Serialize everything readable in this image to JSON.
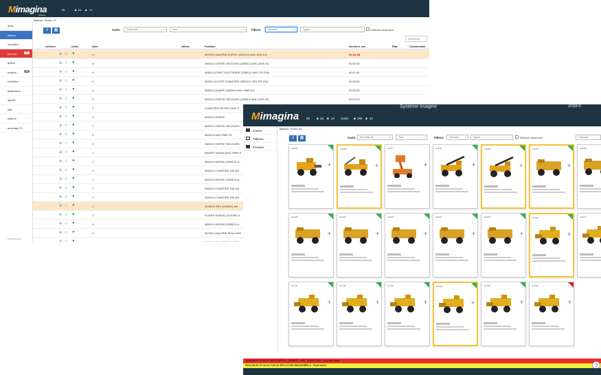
{
  "window1": {
    "app_name": "imagina",
    "app_byline": "by Mappia",
    "stats": [
      "55",
      "63",
      "74"
    ],
    "subtitle": "Tableau: Tiroirs: 43",
    "sidebar": [
      {
        "label": "artes"
      },
      {
        "label": "ableau"
      },
      {
        "label": "opération"
      },
      {
        "label": "bserver",
        "badge": "11"
      },
      {
        "label": "apteur"
      },
      {
        "label": "ocalisa...",
        "badge": "30"
      },
      {
        "label": "entilation"
      },
      {
        "label": "lanificateur"
      },
      {
        "label": "apport"
      },
      {
        "label": "utils"
      },
      {
        "label": "ystème"
      },
      {
        "label": "auvetage R..."
      }
    ],
    "sidebar_footer": "Déconnexion",
    "filters": {
      "carte_label": "Carte:",
      "carte_value": "Souterrain",
      "carte2_value": "Tout",
      "filtres_label": "Filtres:",
      "filtre_value": "Nomade",
      "types_placeholder": "Types...",
      "detecte_label": "Détecté seulement",
      "search_placeholder": "Recherche"
    },
    "columns": [
      "Actions",
      "Icône",
      "Nom",
      "Utilisé",
      "Position",
      "Dernière vue",
      "État",
      "Commentair"
    ],
    "rows": [
      {
        "name": "A",
        "position": "0675C4 GALERIE EXPLO. (0675C4-AHC-EXE-01)",
        "seen": "03:14:48",
        "hl": true,
        "red": true
      },
      {
        "name": "A",
        "position": "0600C4 SORTIE SECOURS (0600C4-AHC-ASS-01)",
        "seen": "00:00:44"
      },
      {
        "name": "A",
        "position": "0550C4 POINT SOUTIRAGE (0550C4-AHC-PS-255)",
        "seen": "00:11:09"
      },
      {
        "name": "A",
        "position": "0525C4 ACCES CHANTIER (0525C4-YEH-PS-230)",
        "seen": "00:00:00"
      },
      {
        "name": "A",
        "position": "0485C4 RAMPE (0485C4-AHC-RMP-01)",
        "seen": "00:00:02"
      },
      {
        "name": "A",
        "position": "0600C4 SORTIE SECOURS (0600C4-AHC-ASS-01)",
        "seen": "00:00:03"
      },
      {
        "name": "E",
        "position": "CHANTIER (0475C4-AHC-F",
        "seen": ""
      },
      {
        "name": "C",
        "position": "0440C4 RAMPE",
        "seen": ""
      },
      {
        "name": "C",
        "position": "0600C4 SORTIE SECOURS",
        "seen": ""
      },
      {
        "name": "E",
        "position": "0600C4-AHC-RMP-01",
        "seen": ""
      },
      {
        "name": "C",
        "position": "0600C4 SORTIE SECOURS",
        "seen": ""
      },
      {
        "name": "C",
        "position": "RAMPE SIGMA (AHC-RMP-S",
        "seen": ""
      },
      {
        "name": "C",
        "position": "0600C4 NIVEAU (0600C4-A",
        "seen": ""
      },
      {
        "name": "C",
        "position": "0525C4 CHANTIER 255 (05",
        "seen": ""
      },
      {
        "name": "C",
        "position": "0600C4 NIVEAU (0600C4-A",
        "seen": ""
      },
      {
        "name": "F",
        "position": "0500C4 CHANTIER 255 (05",
        "seen": ""
      },
      {
        "name": "C",
        "position": "0500C4 CHANTIER 255 (05",
        "seen": ""
      },
      {
        "name": "C",
        "position": "0135SG GEX (0135SG-AH",
        "seen": "",
        "hl": true
      },
      {
        "name": "C",
        "position": "0130SE NIVEAU (0130SE-A",
        "seen": ""
      },
      {
        "name": "A",
        "position": "0650C4 NIVEAU (0650C4-A",
        "seen": ""
      },
      {
        "name": "A",
        "position": "0475C4 GALERIE ROULAGE",
        "seen": ""
      },
      {
        "name": "A",
        "position": "0625C4 CHANTIER (0625C",
        "seen": ""
      }
    ]
  },
  "window2": {
    "app_name": "imagina",
    "system_title": "Système Imagine",
    "date": "2019-0",
    "stats": [
      "55",
      "34",
      "44"
    ],
    "carte_label": "Carte:",
    "stats2": [
      "265",
      "41"
    ],
    "subtitle": "Tableau: Tiroirs: 81",
    "sidebar": [
      {
        "label": "Cartes"
      },
      {
        "label": "Tableau"
      },
      {
        "label": "Pousser"
      }
    ],
    "filters": {
      "carte_label": "Carte:",
      "carte_value": "Mouvelle ab",
      "carte2_value": "Tout",
      "filtres_label": "Filtres:",
      "filtre_value": "Véhicule",
      "types_placeholder": "Types...",
      "detecte_label": "Détecté seulement",
      "search_placeholder": "Chercher"
    },
    "cards": [
      {
        "id": "CAM47",
        "flag": "green",
        "sel": false,
        "kind": "loader"
      },
      {
        "id": "CUR40",
        "flag": "green",
        "sel": true,
        "kind": "grader"
      },
      {
        "id": "LIF20",
        "flag": "none",
        "sel": false,
        "kind": "lift"
      },
      {
        "id": "CUR11",
        "flag": "green",
        "sel": false,
        "kind": "crane"
      },
      {
        "id": "UGR10",
        "flag": "green",
        "sel": true,
        "kind": "crane"
      },
      {
        "id": "UNC07",
        "flag": "green",
        "sel": true,
        "kind": "truck"
      },
      {
        "id": "CAM02",
        "flag": "green",
        "sel": false,
        "kind": "truck"
      },
      {
        "id": "CHA08",
        "flag": "green",
        "sel": false,
        "kind": "truck"
      },
      {
        "id": "CHA06",
        "flag": "green",
        "sel": false,
        "kind": "truck"
      },
      {
        "id": "CHA03",
        "flag": "green",
        "sel": false,
        "kind": "truck"
      },
      {
        "id": "CHA01",
        "flag": "green",
        "sel": false,
        "kind": "truck"
      },
      {
        "id": "CHA08",
        "flag": "green",
        "sel": false,
        "kind": "truck"
      },
      {
        "id": "CHA07",
        "flag": "green",
        "sel": true,
        "kind": "loader2"
      },
      {
        "id": "CHA12",
        "flag": "green",
        "sel": false,
        "kind": "loader2"
      },
      {
        "id": "CHA41",
        "flag": "green",
        "sel": false,
        "kind": "loader2"
      },
      {
        "id": "CHA46",
        "flag": "green",
        "sel": false,
        "kind": "loader2"
      },
      {
        "id": "CHA07",
        "flag": "green",
        "sel": false,
        "kind": "loader2"
      },
      {
        "id": "CHA06",
        "flag": "green",
        "sel": true,
        "kind": "loader2"
      },
      {
        "id": "CHA03",
        "flag": "green",
        "sel": false,
        "kind": "loader2"
      },
      {
        "id": "CHA09",
        "flag": "red",
        "sel": false,
        "kind": "loader2"
      }
    ],
    "tickers": [
      "2019-08-29 07:23:27   DE ET2PP21 : 0525PP : GPP : EQO1 LEO : Lrly too large",
      "2019-08-29 07:12:24   Y1H-12   P61 UT-062   MA13/HIRE-3 : Feed need"
    ]
  }
}
